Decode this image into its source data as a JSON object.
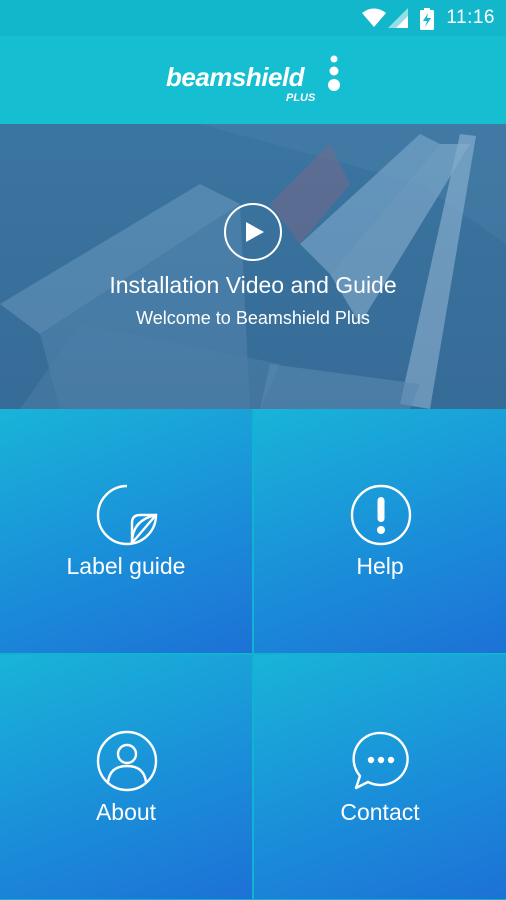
{
  "status_bar": {
    "time": "11:16"
  },
  "header": {
    "logo_text": "beamshield",
    "logo_sub": "PLUS"
  },
  "hero": {
    "title": "Installation Video and Guide",
    "subtitle": "Welcome to Beamshield Plus"
  },
  "tiles": [
    {
      "label": "Label guide",
      "icon": "label-sticker-icon"
    },
    {
      "label": "Help",
      "icon": "exclamation-icon"
    },
    {
      "label": "About",
      "icon": "user-icon"
    },
    {
      "label": "Contact",
      "icon": "chat-bubble-icon"
    }
  ],
  "colors": {
    "header": "#16bed2",
    "tile_top": "#19b4d8",
    "tile_bottom": "#1d71d6"
  }
}
